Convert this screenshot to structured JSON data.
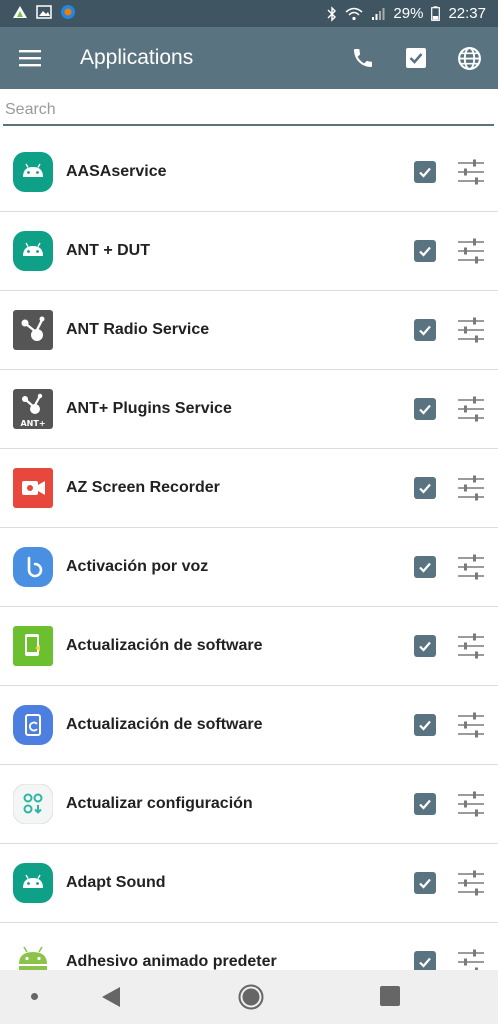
{
  "status_bar": {
    "battery": "29%",
    "time": "22:37"
  },
  "toolbar": {
    "title": "Applications",
    "menu_icon": "hamburger-menu-icon",
    "actions": [
      "phone-icon",
      "check-box-icon",
      "globe-icon"
    ]
  },
  "search": {
    "placeholder": "Search",
    "value": ""
  },
  "apps": [
    {
      "name": "AASAservice",
      "icon": "android-teal",
      "checked": true
    },
    {
      "name": "ANT + DUT",
      "icon": "android-teal",
      "checked": true
    },
    {
      "name": "ANT Radio Service",
      "icon": "ant-radio",
      "checked": true
    },
    {
      "name": "ANT+ Plugins Service",
      "icon": "ant-plugins",
      "checked": true
    },
    {
      "name": "AZ Screen Recorder",
      "icon": "az-recorder",
      "checked": true
    },
    {
      "name": "Activación por voz",
      "icon": "bixby-voice",
      "checked": true
    },
    {
      "name": "Actualización de software",
      "icon": "software-update-green",
      "checked": true
    },
    {
      "name": "Actualización de software",
      "icon": "software-update-blue",
      "checked": true
    },
    {
      "name": "Actualizar configuración",
      "icon": "config-update",
      "checked": true
    },
    {
      "name": "Adapt Sound",
      "icon": "android-teal",
      "checked": true
    },
    {
      "name": "Adhesivo animado predeter",
      "icon": "android-green",
      "checked": true
    }
  ],
  "colors": {
    "status_bar": "#3f5562",
    "toolbar": "#5a7380",
    "checkbox": "#5a7380"
  }
}
